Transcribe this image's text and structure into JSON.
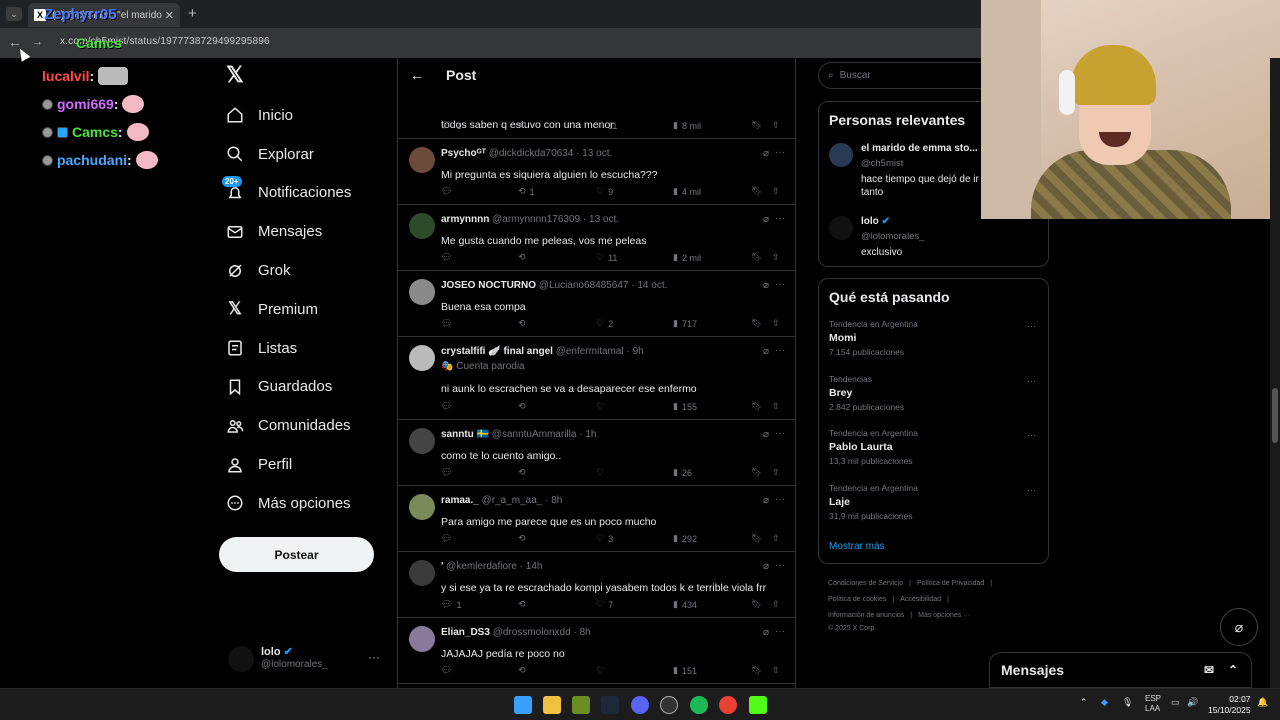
{
  "browser": {
    "tab_title": "(2) @ch5mist: \"el marido de emma stone ...",
    "url": "x.com/ch5mist/status/1977738729499295896"
  },
  "stream_overlay": {
    "top_users": [
      "Zephyrr05",
      "Camcs"
    ],
    "chat": [
      {
        "user": "lucalvil",
        "color": "#ff4a4a"
      },
      {
        "user": "gomi669",
        "color": "#d26bff"
      },
      {
        "user": "Camcs",
        "color": "#49e43c"
      },
      {
        "user": "pachudani",
        "color": "#4aa8ff"
      }
    ]
  },
  "sidebar": {
    "items": [
      {
        "label": "Inicio",
        "icon": "home-icon"
      },
      {
        "label": "Explorar",
        "icon": "search-icon"
      },
      {
        "label": "Notificaciones",
        "icon": "bell-icon",
        "badge": "20+"
      },
      {
        "label": "Mensajes",
        "icon": "envelope-icon"
      },
      {
        "label": "Grok",
        "icon": "grok-icon"
      },
      {
        "label": "Premium",
        "icon": "x-logo-icon"
      },
      {
        "label": "Listas",
        "icon": "list-icon"
      },
      {
        "label": "Guardados",
        "icon": "bookmark-icon"
      },
      {
        "label": "Comunidades",
        "icon": "people-icon"
      },
      {
        "label": "Perfil",
        "icon": "person-icon"
      },
      {
        "label": "Más opciones",
        "icon": "more-circle-icon"
      }
    ],
    "post_button": "Postear",
    "account": {
      "name": "lolo",
      "handle": "@lolomorales_"
    }
  },
  "main": {
    "title": "Post",
    "replies": [
      {
        "name": "",
        "handle": "",
        "date": "",
        "text": "todos saben q estuvo con una menor",
        "replies": "1",
        "reposts": "",
        "likes": "11",
        "views": "8 mil"
      },
      {
        "name": "Psychoᴳᵀ",
        "handle": "@dickdickda70634",
        "date": "13 oct.",
        "text": "Mi pregunta es siquiera alguien lo escucha???",
        "replies": "",
        "reposts": "1",
        "likes": "9",
        "views": "4 mil"
      },
      {
        "name": "armynnnn",
        "handle": "@armynnnn176309",
        "date": "13 oct.",
        "text": "Me gusta cuando me peleas, vos me peleas",
        "replies": "",
        "reposts": "",
        "likes": "11",
        "views": "2 mil"
      },
      {
        "name": "JOSEO NOCTURNO",
        "handle": "@Luciano68485647",
        "date": "14 oct.",
        "text": "Buena esa compa",
        "replies": "",
        "reposts": "",
        "likes": "2",
        "views": "717"
      },
      {
        "name": "crystalfifi 🪽 final angel",
        "handle": "@enfermitamal",
        "date": "9h",
        "sub": "Cuenta parodia",
        "text": "ni aunk lo escrachen se va a desaparecer ese enfermo",
        "replies": "",
        "reposts": "",
        "likes": "",
        "views": "155"
      },
      {
        "name": "sanntu 🇸🇪",
        "handle": "@sanntuAmmarilla",
        "date": "1h",
        "text": "como te lo cuento amigo..",
        "replies": "",
        "reposts": "",
        "likes": "",
        "views": "26"
      },
      {
        "name": "ramaa._",
        "handle": "@r_a_m_aa_",
        "date": "8h",
        "text": "Para amigo me parece que es un poco mucho",
        "replies": "",
        "reposts": "",
        "likes": "3",
        "views": "292"
      },
      {
        "name": "'",
        "handle": "@kemlerdafiore",
        "date": "14h",
        "text": "y si ese ya ta re escrachado kompi yasabem todos k e terrible viola frr",
        "replies": "1",
        "reposts": "",
        "likes": "7",
        "views": "434"
      },
      {
        "name": "Elian_DS3",
        "handle": "@drossmolonxdd",
        "date": "8h",
        "text": "JAJAJAJ pedía re poco no",
        "replies": "",
        "reposts": "",
        "likes": "",
        "views": "151"
      }
    ]
  },
  "right": {
    "search_placeholder": "Buscar",
    "relevant": {
      "title": "Personas relevantes",
      "people": [
        {
          "name": "el marido de emma sto...",
          "handle": "@ch5mist",
          "bio": "hace tiempo que dejó de ir",
          "bio2": "tanto"
        },
        {
          "name": "lolo",
          "handle": "@lolomorales_",
          "bio": "exclusivo",
          "bio2": ""
        }
      ]
    },
    "trends": {
      "title": "Qué está pasando",
      "items": [
        {
          "category": "Tendencia en Argentina",
          "name": "Momi",
          "count": "7.154 publicaciones"
        },
        {
          "category": "Tendencias",
          "name": "Brey",
          "count": "2.842 publicaciones"
        },
        {
          "category": "Tendencia en Argentina",
          "name": "Pablo Laurta",
          "count": "13,3 mil publicaciones"
        },
        {
          "category": "Tendencia en Argentina",
          "name": "Laje",
          "count": "31,9 mil publicaciones"
        }
      ],
      "show_more": "Mostrar más"
    },
    "footer": {
      "line1": [
        "Condiciones de Servicio",
        "|",
        "Política de Privacidad",
        "|"
      ],
      "line2": [
        "Política de cookies",
        "|",
        "Accesibilidad",
        "|"
      ],
      "line3": [
        "Información de anuncios",
        "|",
        "Más opciones ···"
      ],
      "copyright": "© 2025 X Corp."
    }
  },
  "messages_dock": {
    "title": "Mensajes"
  },
  "taskbar": {
    "lang": "ESP",
    "lang2": "LAA",
    "time": "02:07",
    "date": "15/10/2025"
  },
  "colors": {
    "accent": "#1d9bf0",
    "bg": "#000000",
    "border": "#2f3336",
    "muted": "#71767b"
  }
}
